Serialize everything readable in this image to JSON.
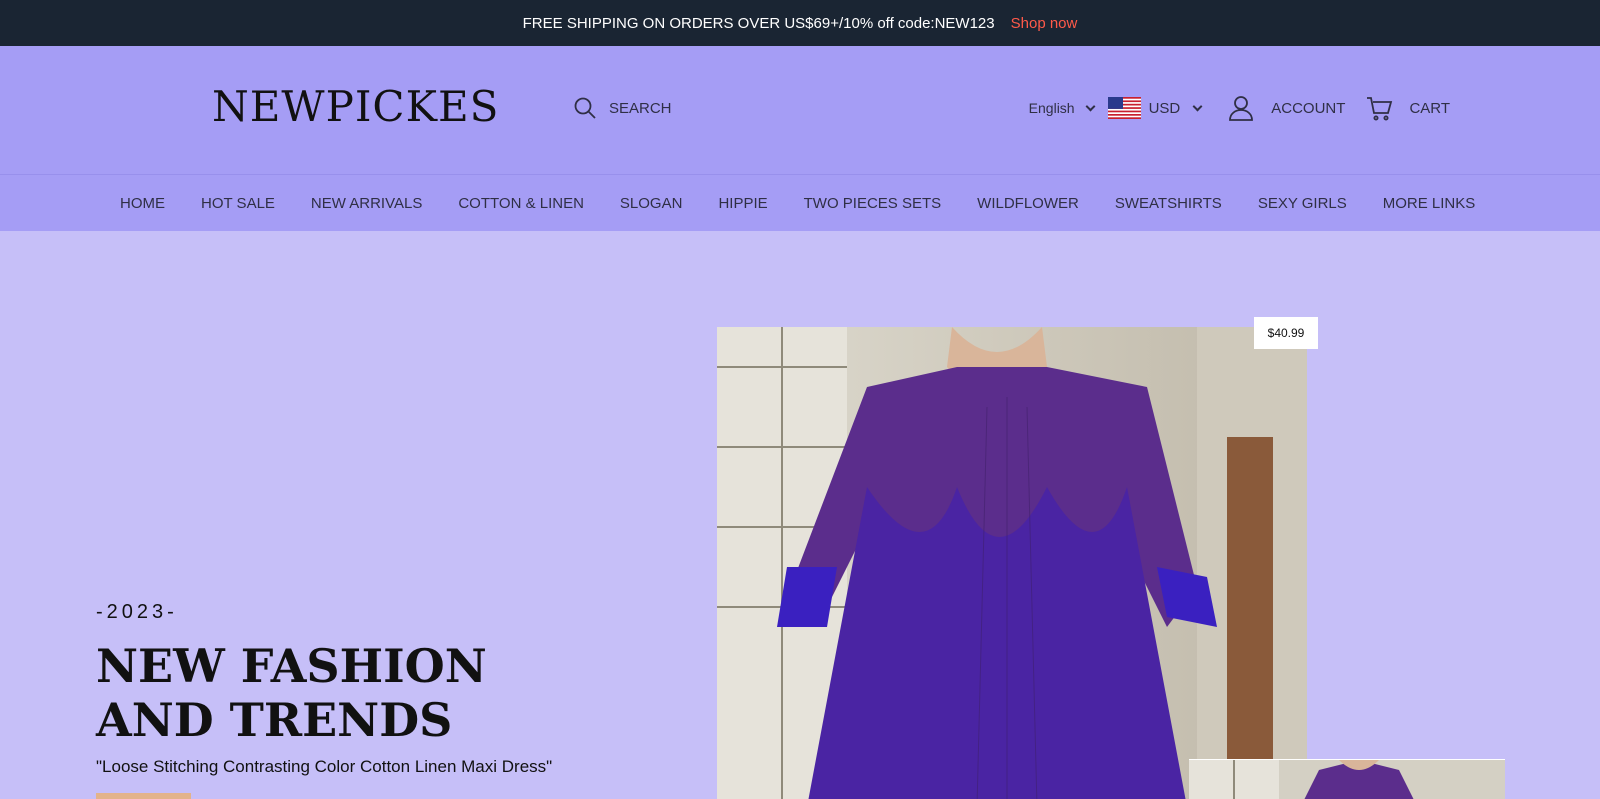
{
  "announcement": {
    "text": "FREE SHIPPING ON ORDERS OVER US$69+/10% off code:NEW123",
    "link": "Shop now"
  },
  "header": {
    "logo": "NEWPICKES",
    "search_label": "SEARCH",
    "language": "English",
    "currency": "USD",
    "account_label": "ACCOUNT",
    "cart_label": "CART"
  },
  "nav": {
    "items": [
      "HOME",
      "HOT SALE",
      "NEW ARRIVALS",
      "COTTON & LINEN",
      "SLOGAN",
      "HIPPIE",
      "TWO PIECES SETS",
      "WILDFLOWER",
      "SWEATSHIRTS",
      "SEXY GIRLS",
      "MORE LINKS"
    ]
  },
  "hero": {
    "year": "-2023-",
    "title": "NEW FASHION AND TRENDS",
    "subtitle": "\"Loose Stitching Contrasting Color Cotton Linen Maxi Dress\""
  },
  "product": {
    "price": "$40.99"
  },
  "colors": {
    "announce_bg": "#1a2533",
    "header_bg": "#a59df5",
    "hero_bg": "#c6bff8",
    "shop_now": "#ff5a4a",
    "dress_purple": "#5b2d8c"
  },
  "icons": [
    "search-icon",
    "chevron-down-icon",
    "us-flag-icon",
    "user-icon",
    "cart-icon"
  ]
}
